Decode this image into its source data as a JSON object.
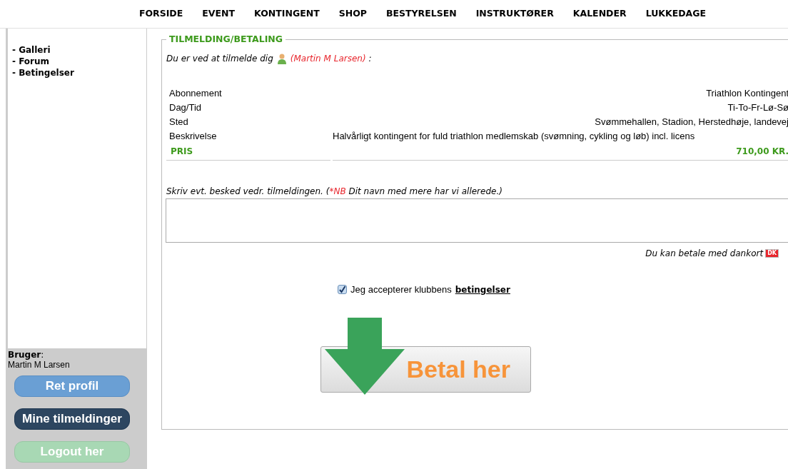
{
  "nav": [
    {
      "label": "FORSIDE"
    },
    {
      "label": "EVENT"
    },
    {
      "label": "KONTINGENT"
    },
    {
      "label": "SHOP"
    },
    {
      "label": "BESTYRELSEN"
    },
    {
      "label": "INSTRUKTØRER"
    },
    {
      "label": "KALENDER"
    },
    {
      "label": "LUKKEDAGE"
    }
  ],
  "sidebar": {
    "links": [
      "- Galleri",
      "- Forum",
      "- Betingelser"
    ],
    "user_label": "Bruger",
    "user_colon": ":",
    "user_name": "Martin M Larsen",
    "buttons": [
      {
        "label": "Ret profil",
        "kind": "light"
      },
      {
        "label": "Mine tilmeldinger",
        "kind": "dark"
      },
      {
        "label": "Logout her",
        "kind": "pale"
      }
    ]
  },
  "form": {
    "legend": "TILMELDING/BETALING",
    "intro": {
      "prefix": "Du er ved at tilmelde dig",
      "name": "(Martin M Larsen)",
      "suffix": ":"
    },
    "details": [
      {
        "label": "Abonnement",
        "value": "Triathlon Kontingent",
        "kind": "short"
      },
      {
        "label": "Dag/Tid",
        "value": "Ti-To-Fr-Lø-Sø",
        "kind": "short"
      },
      {
        "label": "Sted",
        "value": "Svømmehallen, Stadion, Herstedhøje, landevej",
        "kind": "short"
      },
      {
        "label": "Beskrivelse",
        "value": "Halvårligt kontingent for fuld triathlon medlemskab (svømning, cykling og løb) incl. licens",
        "kind": "long"
      }
    ],
    "price": {
      "label": "PRIS",
      "value": "710,00 KR."
    },
    "message": {
      "text": "Skriv evt. besked vedr. tilmeldingen. (",
      "mark": "*NB",
      "note": "Dit navn med mere har vi allerede.)"
    },
    "dankort": {
      "text": "Du kan betale med dankort",
      "logo": "DK"
    },
    "terms": {
      "checked": true,
      "text": "Jeg accepterer klubbens",
      "link": "betingelser"
    },
    "pay_button": "Betal her"
  }
}
